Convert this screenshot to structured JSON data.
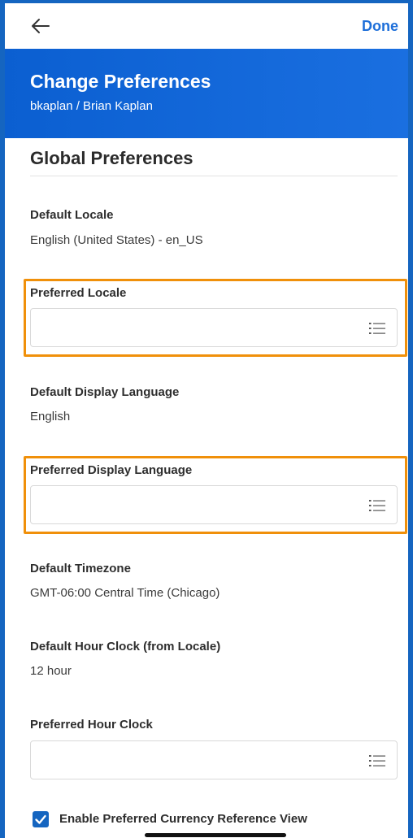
{
  "header": {
    "done_label": "Done",
    "title": "Change Preferences",
    "subtitle": "bkaplan / Brian Kaplan"
  },
  "section": {
    "title": "Global Preferences"
  },
  "fields": {
    "default_locale": {
      "label": "Default Locale",
      "value": "English (United States) - en_US"
    },
    "preferred_locale": {
      "label": "Preferred Locale",
      "value": ""
    },
    "default_display_language": {
      "label": "Default Display Language",
      "value": "English"
    },
    "preferred_display_language": {
      "label": "Preferred Display Language",
      "value": ""
    },
    "default_timezone": {
      "label": "Default Timezone",
      "value": "GMT-06:00 Central Time (Chicago)"
    },
    "default_hour_clock": {
      "label": "Default Hour Clock (from Locale)",
      "value": "12 hour"
    },
    "preferred_hour_clock": {
      "label": "Preferred Hour Clock",
      "value": ""
    }
  },
  "checkbox": {
    "label": "Enable Preferred Currency Reference View",
    "checked": true
  },
  "colors": {
    "brand_blue": "#0b5fd1",
    "link_blue": "#1e6fd9",
    "highlight_orange": "#f0900a"
  },
  "icons": {
    "back": "arrow-left-icon",
    "prompt": "list-icon",
    "check": "checkmark-icon"
  }
}
